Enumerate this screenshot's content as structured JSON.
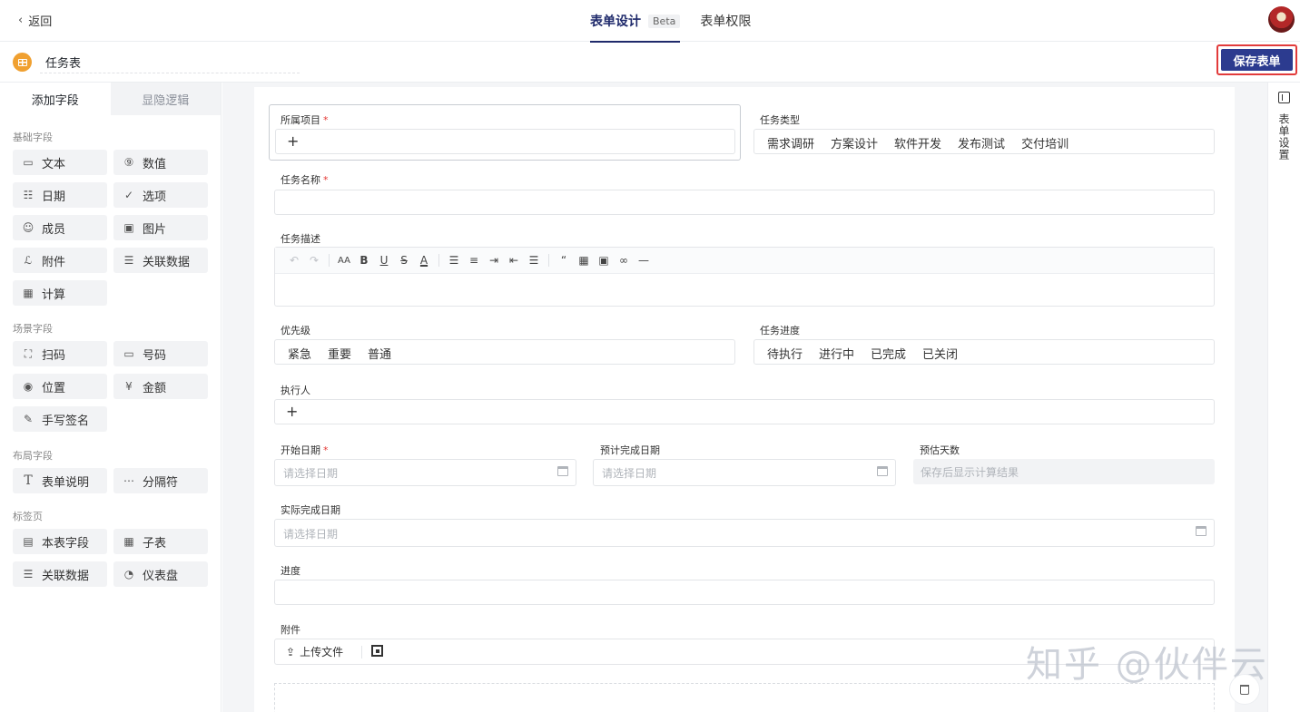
{
  "header": {
    "back_label": "返回",
    "tabs": [
      {
        "label": "表单设计",
        "badge": "Beta",
        "active": true
      },
      {
        "label": "表单权限",
        "active": false
      }
    ]
  },
  "subbar": {
    "form_name": "任务表",
    "save_label": "保存表单"
  },
  "left_panel": {
    "tabs": [
      "添加字段",
      "显隐逻辑"
    ],
    "groups": [
      {
        "title": "基础字段",
        "items": [
          "文本",
          "数值",
          "日期",
          "选项",
          "成员",
          "图片",
          "附件",
          "关联数据",
          "计算"
        ]
      },
      {
        "title": "场景字段",
        "items": [
          "扫码",
          "号码",
          "位置",
          "金额",
          "手写签名"
        ]
      },
      {
        "title": "布局字段",
        "items": [
          "表单说明",
          "分隔符"
        ]
      },
      {
        "title": "标签页",
        "items": [
          "本表字段",
          "子表",
          "关联数据",
          "仪表盘"
        ]
      }
    ]
  },
  "form": {
    "project": {
      "label": "所属项目",
      "required": true
    },
    "task_type": {
      "label": "任务类型",
      "options": [
        "需求调研",
        "方案设计",
        "软件开发",
        "发布测试",
        "交付培训"
      ]
    },
    "task_name": {
      "label": "任务名称",
      "required": true
    },
    "task_desc": {
      "label": "任务描述"
    },
    "priority": {
      "label": "优先级",
      "options": [
        "紧急",
        "重要",
        "普通"
      ]
    },
    "progress_status": {
      "label": "任务进度",
      "options": [
        "待执行",
        "进行中",
        "已完成",
        "已关闭"
      ]
    },
    "assignee": {
      "label": "执行人"
    },
    "start_date": {
      "label": "开始日期",
      "required": true,
      "placeholder": "请选择日期"
    },
    "planned_end": {
      "label": "预计完成日期",
      "placeholder": "请选择日期"
    },
    "est_days": {
      "label": "预估天数",
      "placeholder": "保存后显示计算结果"
    },
    "actual_end": {
      "label": "实际完成日期",
      "placeholder": "请选择日期"
    },
    "progress": {
      "label": "进度"
    },
    "attachment": {
      "label": "附件",
      "upload_label": "上传文件"
    },
    "required_mark": "*"
  },
  "right_strip": {
    "label": "表单设置"
  },
  "watermark": "知乎 @伙伴云"
}
